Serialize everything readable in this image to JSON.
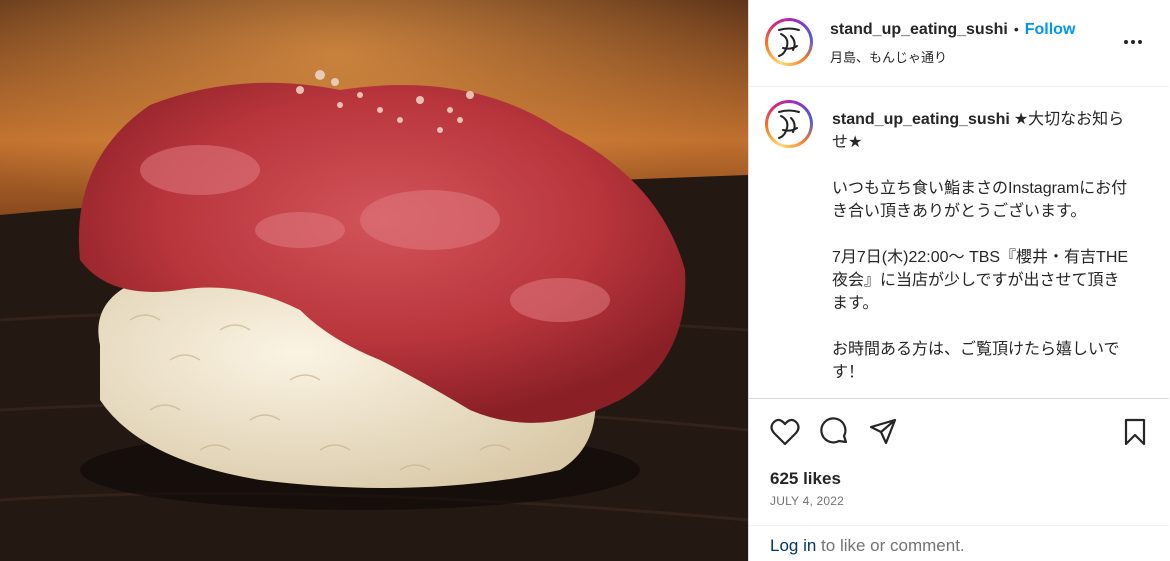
{
  "post": {
    "username": "stand_up_eating_sushi",
    "dot": "•",
    "follow_label": "Follow",
    "location": "月島、もんじゃ通り",
    "more_icon": "more-horizontal-icon"
  },
  "caption": {
    "username": "stand_up_eating_sushi",
    "text": "★大切なお知らせ★\n\nいつも立ち食い鮨まさのInstagramにお付き合い頂きありがとうございます。\n\n7月7日(木)22:00〜 TBS『櫻井・有吉THE夜会』に当店が少しですが出させて頂きます。\n\nお時間ある方は、ご覧頂けたら嬉しいです！"
  },
  "actions": {
    "icons": [
      "heart-icon",
      "comment-icon",
      "share-icon",
      "bookmark-icon"
    ],
    "likes": "625 likes",
    "date": "JULY 4, 2022"
  },
  "login": {
    "link": "Log in",
    "rest": " to like or comment."
  },
  "colors": {
    "accent": "#0095f6",
    "text": "#262626",
    "muted": "#737373",
    "link_dark": "#00376b",
    "border": "#dbdbdb"
  }
}
